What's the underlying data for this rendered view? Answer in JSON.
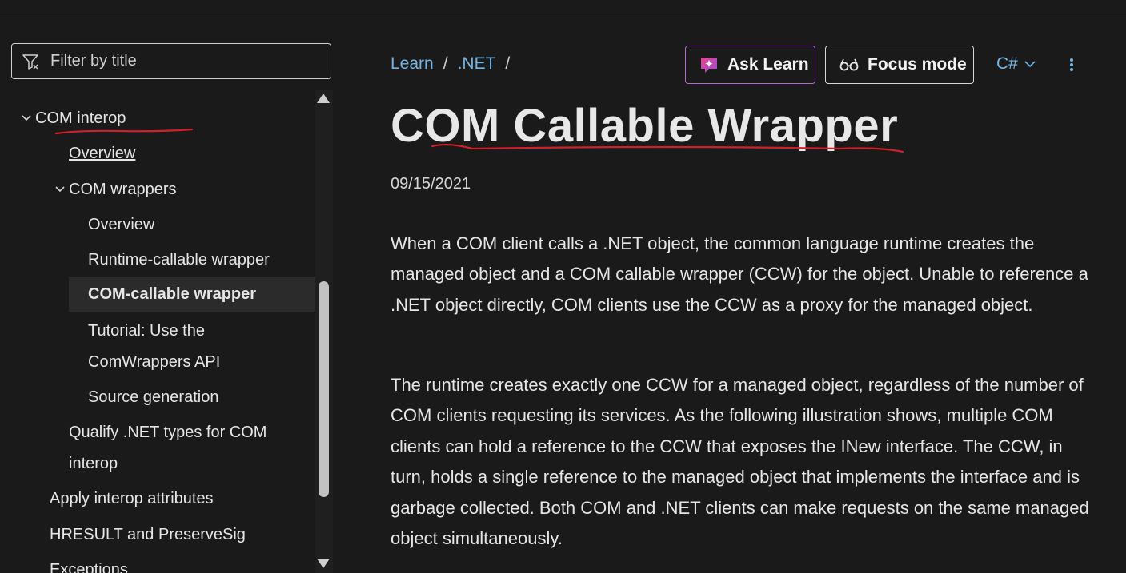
{
  "filter": {
    "placeholder": "Filter by title"
  },
  "toc": {
    "items": [
      {
        "label": "COM interop"
      },
      {
        "label": "Overview"
      },
      {
        "label": "COM wrappers"
      },
      {
        "label": "Overview"
      },
      {
        "label": "Runtime-callable wrapper"
      },
      {
        "label": "COM-callable wrapper"
      },
      {
        "label": "Tutorial: Use the ComWrappers API"
      },
      {
        "label": "Source generation"
      },
      {
        "label": "Qualify .NET types for COM interop"
      },
      {
        "label": "Apply interop attributes"
      },
      {
        "label": "HRESULT and PreserveSig"
      },
      {
        "label": "Exceptions"
      }
    ]
  },
  "breadcrumb": {
    "items": [
      "Learn",
      ".NET"
    ],
    "separator": "/"
  },
  "header": {
    "ask_label": "Ask Learn",
    "focus_label": "Focus mode",
    "language": "C#"
  },
  "article": {
    "title": "COM Callable Wrapper",
    "date": "09/15/2021",
    "paragraphs": [
      "When a COM client calls a .NET object, the common language runtime creates the managed object and a COM callable wrapper (CCW) for the object. Unable to reference a .NET object directly, COM clients use the CCW as a proxy for the managed object.",
      "The runtime creates exactly one CCW for a managed object, regardless of the number of COM clients requesting its services. As the following illustration shows, multiple COM clients can hold a reference to the CCW that exposes the INew interface. The CCW, in turn, holds a single reference to the managed object that implements the interface and is garbage collected. Both COM and .NET clients can make requests on the same managed object simultaneously."
    ]
  },
  "colors": {
    "background": "#1a1a1a",
    "link": "#75b6e7",
    "ask_border": "#b36ad6",
    "annotation": "#d0202a"
  }
}
